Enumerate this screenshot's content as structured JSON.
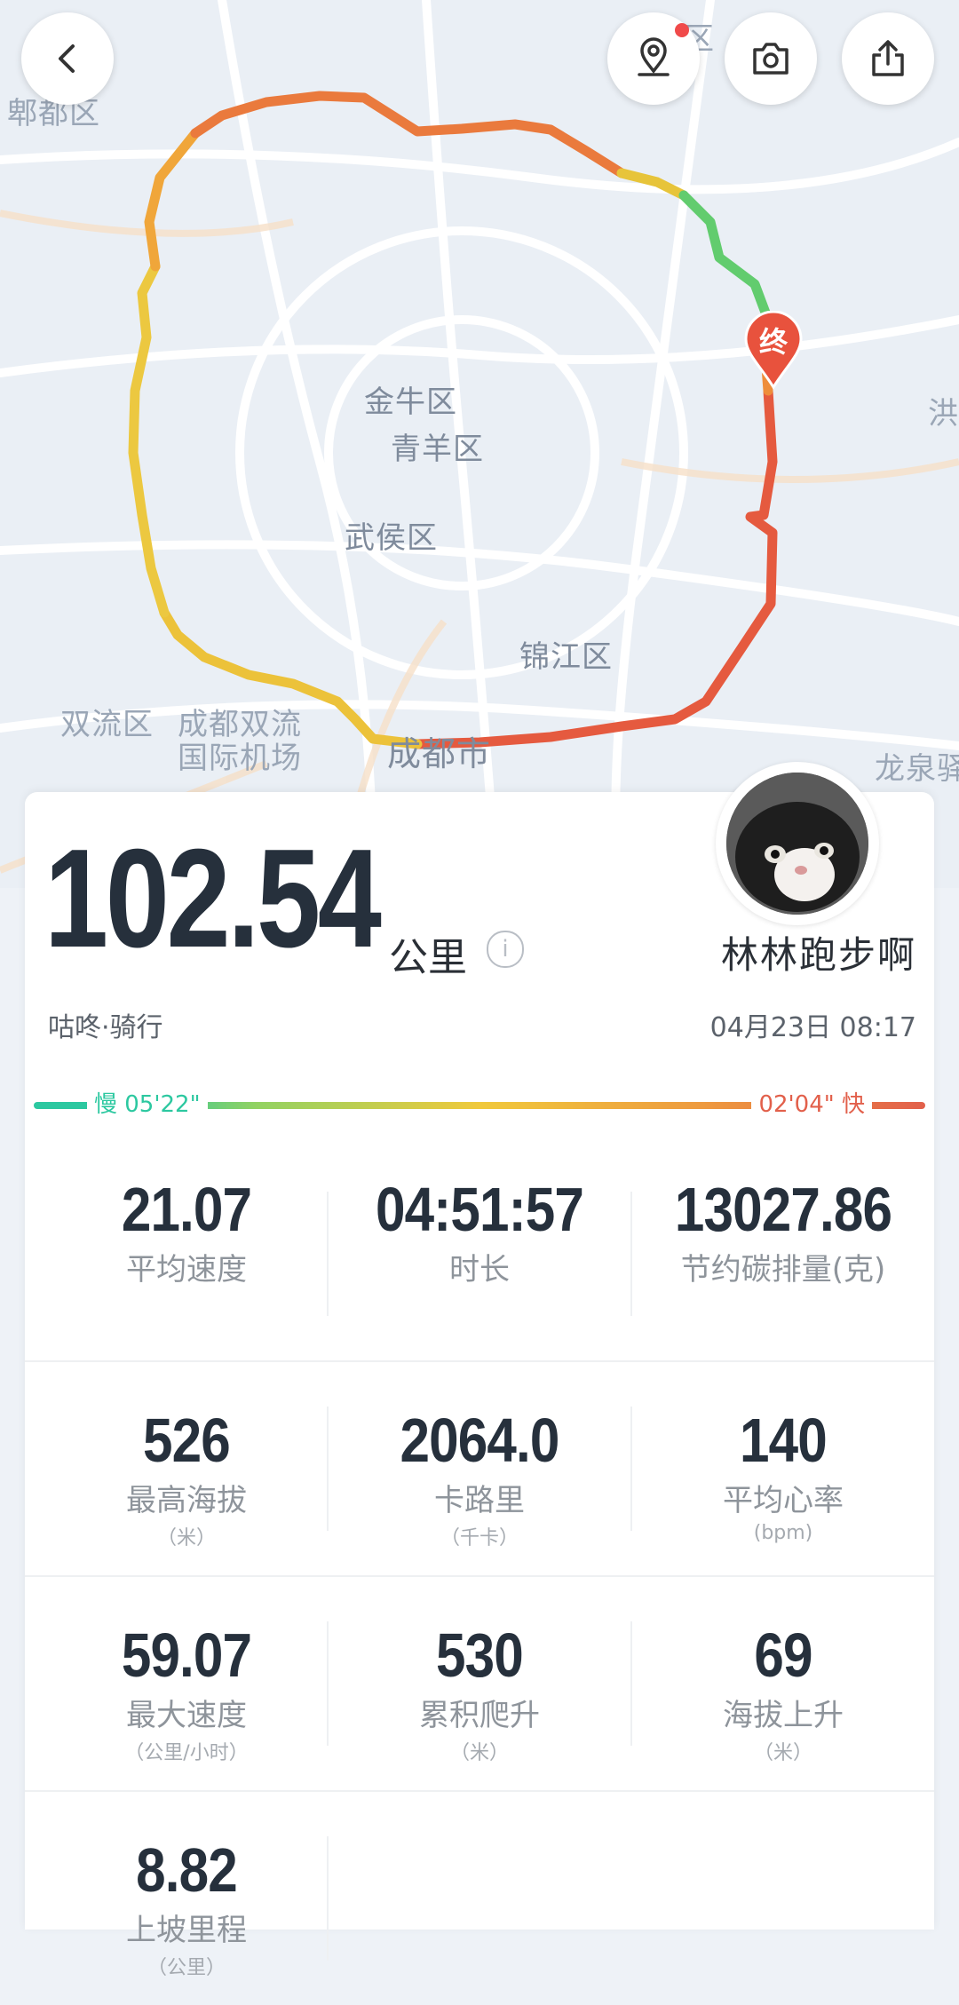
{
  "map": {
    "labels": {
      "pixian": "郫都区",
      "jinniu": "金牛区",
      "qingyang": "青羊区",
      "wuhou": "武侯区",
      "jinjiang": "锦江区",
      "shuangliu": "双流区",
      "airport_line1": "成都双流",
      "airport_line2": "国际机场",
      "chengdu": "成都市",
      "longquan": "龙泉驿",
      "hong": "洪",
      "qu_top": "区"
    },
    "end_marker": "终",
    "route_colors": [
      "#f0c93c",
      "#e9b43a",
      "#ee8a3a",
      "#e96a3f",
      "#e55a3f",
      "#7cd36a",
      "#48c982"
    ]
  },
  "toolbar": {
    "back_icon": "chevron-left-icon",
    "location_icon": "location-pin-icon",
    "camera_icon": "camera-icon",
    "share_icon": "share-icon"
  },
  "summary": {
    "distance": "102.54",
    "distance_unit": "公里",
    "info_icon": "i",
    "username": "林林跑步啊",
    "sport_type": "咕咚·骑行",
    "datetime": "04月23日 08:17",
    "pace_slow": "慢 05'22\"",
    "pace_fast": "02'04\" 快",
    "pace_colors": {
      "slow": "#2cc8a0",
      "mid": "#f0c93c",
      "fast": "#e2604b"
    }
  },
  "stats": [
    [
      {
        "value": "21.07",
        "label": "平均速度",
        "unit": ""
      },
      {
        "value": "04:51:57",
        "label": "时长",
        "unit": ""
      },
      {
        "value": "13027.86",
        "label": "节约碳排量(克)",
        "unit": ""
      }
    ],
    [
      {
        "value": "526",
        "label": "最高海拔",
        "unit": "（米）"
      },
      {
        "value": "2064.0",
        "label": "卡路里",
        "unit": "（千卡）"
      },
      {
        "value": "140",
        "label": "平均心率",
        "unit": "(bpm)"
      }
    ],
    [
      {
        "value": "59.07",
        "label": "最大速度",
        "unit": "（公里/小时）"
      },
      {
        "value": "530",
        "label": "累积爬升",
        "unit": "（米）"
      },
      {
        "value": "69",
        "label": "海拔上升",
        "unit": "（米）"
      }
    ],
    [
      {
        "value": "8.82",
        "label": "上坡里程",
        "unit": "（公里）"
      }
    ]
  ]
}
